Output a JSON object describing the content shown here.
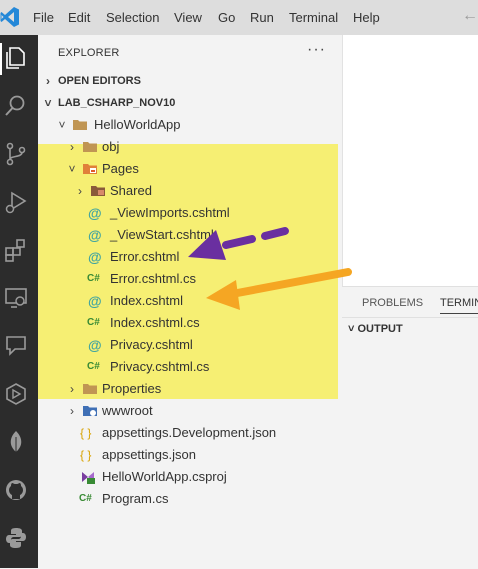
{
  "menu": [
    "File",
    "Edit",
    "Selection",
    "View",
    "Go",
    "Run",
    "Terminal",
    "Help"
  ],
  "colors": {
    "highlight": "#f5ee6c",
    "purple_arrow": "#6a2fa0",
    "orange_arrow": "#f5a623",
    "activitybar": "#2c2c2c"
  },
  "sidebar": {
    "title": "EXPLORER",
    "more": "···",
    "open_editors": "OPEN EDITORS",
    "workspace": "LAB_CSHARP_NOV10",
    "tree": [
      {
        "label": "HelloWorldApp",
        "icon": "folder-icon",
        "chevron": "˅"
      },
      {
        "label": "obj",
        "icon": "folder-icon",
        "chevron": "›"
      },
      {
        "label": "Pages",
        "icon": "pages-folder-icon",
        "chevron": "˅"
      },
      {
        "label": "Shared",
        "icon": "folder-icon",
        "chevron": "›"
      },
      {
        "label": "_ViewImports.cshtml",
        "icon": "razor-icon"
      },
      {
        "label": "_ViewStart.cshtml",
        "icon": "razor-icon"
      },
      {
        "label": "Error.cshtml",
        "icon": "razor-icon"
      },
      {
        "label": "Error.cshtml.cs",
        "icon": "csharp-icon"
      },
      {
        "label": "Index.cshtml",
        "icon": "razor-icon"
      },
      {
        "label": "Index.cshtml.cs",
        "icon": "csharp-icon"
      },
      {
        "label": "Privacy.cshtml",
        "icon": "razor-icon"
      },
      {
        "label": "Privacy.cshtml.cs",
        "icon": "csharp-icon"
      },
      {
        "label": "Properties",
        "icon": "folder-icon",
        "chevron": "›"
      },
      {
        "label": "wwwroot",
        "icon": "globe-folder-icon",
        "chevron": "›"
      },
      {
        "label": "appsettings.Development.json",
        "icon": "json-icon"
      },
      {
        "label": "appsettings.json",
        "icon": "json-icon"
      },
      {
        "label": "HelloWorldApp.csproj",
        "icon": "csproj-icon"
      },
      {
        "label": "Program.cs",
        "icon": "csharp-icon"
      }
    ]
  },
  "glyphs": {
    "razor": "@",
    "csharp": "C#",
    "json": "{ }"
  },
  "panel": {
    "tabs": [
      "PROBLEMS",
      "TERMINAL"
    ],
    "output_label": "OUTPUT",
    "output_chevron": "˅"
  }
}
